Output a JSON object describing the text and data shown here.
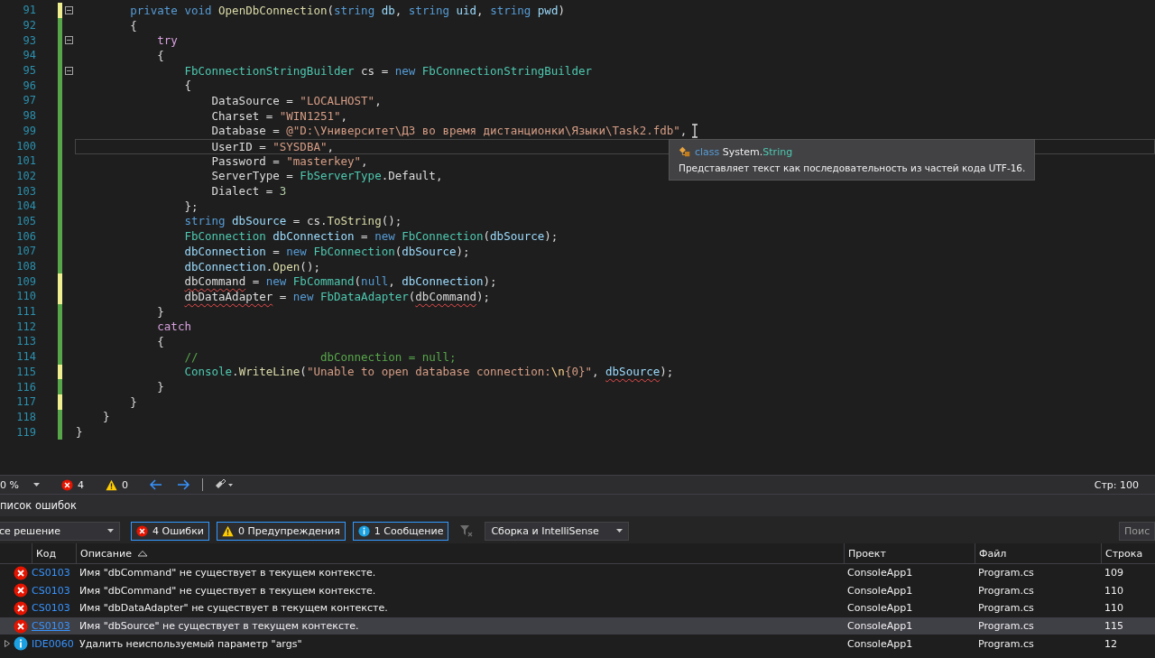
{
  "editor": {
    "lines": [
      {
        "number": "91",
        "saved": false,
        "fold": true,
        "current": false,
        "tokens": [
          {
            "text": "        private ",
            "kind": "kw"
          },
          {
            "text": "void ",
            "kind": "kw"
          },
          {
            "text": "OpenDbConnection",
            "kind": "method"
          },
          {
            "text": "(",
            "kind": "plain"
          },
          {
            "text": "string ",
            "kind": "kw"
          },
          {
            "text": "db",
            "kind": "var"
          },
          {
            "text": ", ",
            "kind": "plain"
          },
          {
            "text": "string ",
            "kind": "kw"
          },
          {
            "text": "uid",
            "kind": "var"
          },
          {
            "text": ", ",
            "kind": "plain"
          },
          {
            "text": "string ",
            "kind": "kw"
          },
          {
            "text": "pwd",
            "kind": "var"
          },
          {
            "text": ")",
            "kind": "plain"
          }
        ]
      },
      {
        "number": "92",
        "saved": true,
        "fold": false,
        "current": false,
        "tokens": [
          {
            "text": "        {",
            "kind": "plain"
          }
        ]
      },
      {
        "number": "93",
        "saved": true,
        "fold": true,
        "current": false,
        "tokens": [
          {
            "text": "            try",
            "kind": "ctrl"
          }
        ]
      },
      {
        "number": "94",
        "saved": true,
        "fold": false,
        "current": false,
        "tokens": [
          {
            "text": "            {",
            "kind": "plain"
          }
        ]
      },
      {
        "number": "95",
        "saved": true,
        "fold": true,
        "current": false,
        "tokens": [
          {
            "text": "                FbConnectionStringBuilder",
            "kind": "type"
          },
          {
            "text": " cs = ",
            "kind": "plain"
          },
          {
            "text": "new ",
            "kind": "kw"
          },
          {
            "text": "FbConnectionStringBuilder",
            "kind": "type"
          }
        ]
      },
      {
        "number": "96",
        "saved": true,
        "fold": false,
        "current": false,
        "tokens": [
          {
            "text": "                {",
            "kind": "plain"
          }
        ]
      },
      {
        "number": "97",
        "saved": true,
        "fold": false,
        "current": false,
        "tokens": [
          {
            "text": "                    DataSource = ",
            "kind": "plain"
          },
          {
            "text": "\"LOCALHOST\"",
            "kind": "str"
          },
          {
            "text": ",",
            "kind": "plain"
          }
        ]
      },
      {
        "number": "98",
        "saved": true,
        "fold": false,
        "current": false,
        "tokens": [
          {
            "text": "                    Charset = ",
            "kind": "plain"
          },
          {
            "text": "\"WIN1251\"",
            "kind": "str"
          },
          {
            "text": ",",
            "kind": "plain"
          }
        ]
      },
      {
        "number": "99",
        "saved": true,
        "fold": false,
        "current": false,
        "tokens": [
          {
            "text": "                    Database = ",
            "kind": "plain"
          },
          {
            "text": "@\"D:\\Университет\\ДЗ во время дистанционки\\Языки\\Task2.fdb\"",
            "kind": "str"
          },
          {
            "text": ",",
            "kind": "plain"
          }
        ]
      },
      {
        "number": "100",
        "saved": true,
        "fold": false,
        "current": true,
        "tokens": [
          {
            "text": "                    UserID = ",
            "kind": "plain"
          },
          {
            "text": "\"SYSDBA\"",
            "kind": "str"
          },
          {
            "text": ",",
            "kind": "plain"
          }
        ]
      },
      {
        "number": "101",
        "saved": true,
        "fold": false,
        "current": false,
        "tokens": [
          {
            "text": "                    Password = ",
            "kind": "plain"
          },
          {
            "text": "\"masterkey\"",
            "kind": "str"
          },
          {
            "text": ",",
            "kind": "plain"
          }
        ]
      },
      {
        "number": "102",
        "saved": true,
        "fold": false,
        "current": false,
        "tokens": [
          {
            "text": "                    ServerType = ",
            "kind": "plain"
          },
          {
            "text": "FbServerType",
            "kind": "type"
          },
          {
            "text": ".Default,",
            "kind": "plain"
          }
        ]
      },
      {
        "number": "103",
        "saved": true,
        "fold": false,
        "current": false,
        "tokens": [
          {
            "text": "                    Dialect = ",
            "kind": "plain"
          },
          {
            "text": "3",
            "kind": "num"
          }
        ]
      },
      {
        "number": "104",
        "saved": true,
        "fold": false,
        "current": false,
        "tokens": [
          {
            "text": "                };",
            "kind": "plain"
          }
        ]
      },
      {
        "number": "105",
        "saved": true,
        "fold": false,
        "current": false,
        "tokens": [
          {
            "text": "                string ",
            "kind": "kw"
          },
          {
            "text": "dbSource",
            "kind": "var"
          },
          {
            "text": " = cs.",
            "kind": "plain"
          },
          {
            "text": "ToString",
            "kind": "method"
          },
          {
            "text": "();",
            "kind": "plain"
          }
        ]
      },
      {
        "number": "106",
        "saved": true,
        "fold": false,
        "current": false,
        "tokens": [
          {
            "text": "                FbConnection ",
            "kind": "type"
          },
          {
            "text": "dbConnection",
            "kind": "var"
          },
          {
            "text": " = ",
            "kind": "plain"
          },
          {
            "text": "new ",
            "kind": "kw"
          },
          {
            "text": "FbConnection",
            "kind": "type"
          },
          {
            "text": "(",
            "kind": "plain"
          },
          {
            "text": "dbSource",
            "kind": "var"
          },
          {
            "text": ");",
            "kind": "plain"
          }
        ]
      },
      {
        "number": "107",
        "saved": true,
        "fold": false,
        "current": false,
        "tokens": [
          {
            "text": "                dbConnection",
            "kind": "var"
          },
          {
            "text": " = ",
            "kind": "plain"
          },
          {
            "text": "new ",
            "kind": "kw"
          },
          {
            "text": "FbConnection",
            "kind": "type"
          },
          {
            "text": "(",
            "kind": "plain"
          },
          {
            "text": "dbSource",
            "kind": "var"
          },
          {
            "text": ");",
            "kind": "plain"
          }
        ]
      },
      {
        "number": "108",
        "saved": true,
        "fold": false,
        "current": false,
        "tokens": [
          {
            "text": "                dbConnection",
            "kind": "var"
          },
          {
            "text": ".",
            "kind": "plain"
          },
          {
            "text": "Open",
            "kind": "method"
          },
          {
            "text": "();",
            "kind": "plain"
          }
        ]
      },
      {
        "number": "109",
        "saved": false,
        "fold": false,
        "current": false,
        "tokens": [
          {
            "text": "                dbCommand",
            "kind": "plain",
            "error": true
          },
          {
            "text": " = ",
            "kind": "plain"
          },
          {
            "text": "new ",
            "kind": "kw"
          },
          {
            "text": "FbCommand",
            "kind": "type"
          },
          {
            "text": "(",
            "kind": "plain"
          },
          {
            "text": "null",
            "kind": "kw"
          },
          {
            "text": ", ",
            "kind": "plain"
          },
          {
            "text": "dbConnection",
            "kind": "var"
          },
          {
            "text": ");",
            "kind": "plain"
          }
        ]
      },
      {
        "number": "110",
        "saved": false,
        "fold": false,
        "current": false,
        "tokens": [
          {
            "text": "                dbDataAdapter",
            "kind": "plain",
            "error": true
          },
          {
            "text": " = ",
            "kind": "plain"
          },
          {
            "text": "new ",
            "kind": "kw"
          },
          {
            "text": "FbDataAdapter",
            "kind": "type"
          },
          {
            "text": "(",
            "kind": "plain"
          },
          {
            "text": "dbCommand",
            "kind": "plain",
            "error": true
          },
          {
            "text": ");",
            "kind": "plain"
          }
        ]
      },
      {
        "number": "111",
        "saved": true,
        "fold": false,
        "current": false,
        "tokens": [
          {
            "text": "            }",
            "kind": "plain"
          }
        ]
      },
      {
        "number": "112",
        "saved": true,
        "fold": false,
        "current": false,
        "tokens": [
          {
            "text": "            catch",
            "kind": "ctrl"
          }
        ]
      },
      {
        "number": "113",
        "saved": true,
        "fold": false,
        "current": false,
        "tokens": [
          {
            "text": "            {",
            "kind": "plain"
          }
        ]
      },
      {
        "number": "114",
        "saved": true,
        "fold": false,
        "current": false,
        "tokens": [
          {
            "text": "                //                  dbConnection = null;",
            "kind": "comment"
          }
        ]
      },
      {
        "number": "115",
        "saved": false,
        "fold": false,
        "current": false,
        "tokens": [
          {
            "text": "                Console",
            "kind": "type"
          },
          {
            "text": ".",
            "kind": "plain"
          },
          {
            "text": "WriteLine",
            "kind": "method"
          },
          {
            "text": "(",
            "kind": "plain"
          },
          {
            "text": "\"Unable to open database connection:",
            "kind": "str"
          },
          {
            "text": "\\n",
            "kind": "esc"
          },
          {
            "text": "{0}\"",
            "kind": "str"
          },
          {
            "text": ", ",
            "kind": "plain"
          },
          {
            "text": "dbSource",
            "kind": "var",
            "error": true
          },
          {
            "text": ");",
            "kind": "plain"
          }
        ]
      },
      {
        "number": "116",
        "saved": true,
        "fold": false,
        "current": false,
        "tokens": [
          {
            "text": "            }",
            "kind": "plain"
          }
        ]
      },
      {
        "number": "117",
        "saved": false,
        "fold": false,
        "current": false,
        "tokens": [
          {
            "text": "        }",
            "kind": "plain"
          }
        ]
      },
      {
        "number": "118",
        "saved": true,
        "fold": false,
        "current": false,
        "tokens": [
          {
            "text": "    }",
            "kind": "plain"
          }
        ]
      },
      {
        "number": "119",
        "saved": true,
        "fold": false,
        "current": false,
        "tokens": [
          {
            "text": "}",
            "kind": "plain"
          }
        ]
      }
    ]
  },
  "tooltip": {
    "keyword": "class",
    "namespace": "System.",
    "type": "String",
    "description": "Представляет текст как последовательность из частей кода UTF-16."
  },
  "status_bar": {
    "zoom": "0 %",
    "errors": "4",
    "warnings": "0",
    "line": "Стр: 100"
  },
  "error_list": {
    "title": "писок ошибок",
    "scope": "се решение",
    "filters": [
      {
        "label": "4 Ошибки",
        "kind": "error",
        "selected": true
      },
      {
        "label": "0 Предупреждения",
        "kind": "warning",
        "selected": true
      },
      {
        "label": "1 Сообщение",
        "kind": "info",
        "selected": true
      }
    ],
    "build_filter": "Сборка и IntelliSense",
    "search": {
      "placeholder": "Поис"
    },
    "columns": [
      {
        "label": "Код",
        "sorted": false
      },
      {
        "label": "Описание",
        "sorted": true
      },
      {
        "label": "Проект",
        "sorted": false
      },
      {
        "label": "Файл",
        "sorted": false
      },
      {
        "label": "Строка",
        "sorted": false
      }
    ],
    "rows": [
      {
        "kind": "error",
        "code": "CS0103",
        "description": "Имя \"dbCommand\" не существует в текущем контексте.",
        "project": "ConsoleApp1",
        "file": "Program.cs",
        "line": "109",
        "selected": false,
        "expandable": false
      },
      {
        "kind": "error",
        "code": "CS0103",
        "description": "Имя \"dbCommand\" не существует в текущем контексте.",
        "project": "ConsoleApp1",
        "file": "Program.cs",
        "line": "110",
        "selected": false,
        "expandable": false
      },
      {
        "kind": "error",
        "code": "CS0103",
        "description": "Имя \"dbDataAdapter\" не существует в текущем контексте.",
        "project": "ConsoleApp1",
        "file": "Program.cs",
        "line": "110",
        "selected": false,
        "expandable": false
      },
      {
        "kind": "error",
        "code": "CS0103",
        "description": "Имя \"dbSource\" не существует в текущем контексте.",
        "project": "ConsoleApp1",
        "file": "Program.cs",
        "line": "115",
        "selected": true,
        "expandable": false
      },
      {
        "kind": "info",
        "code": "IDE0060",
        "description": "Удалить неиспользуемый параметр \"args\"",
        "project": "ConsoleApp1",
        "file": "Program.cs",
        "line": "12",
        "selected": false,
        "expandable": true
      }
    ]
  }
}
